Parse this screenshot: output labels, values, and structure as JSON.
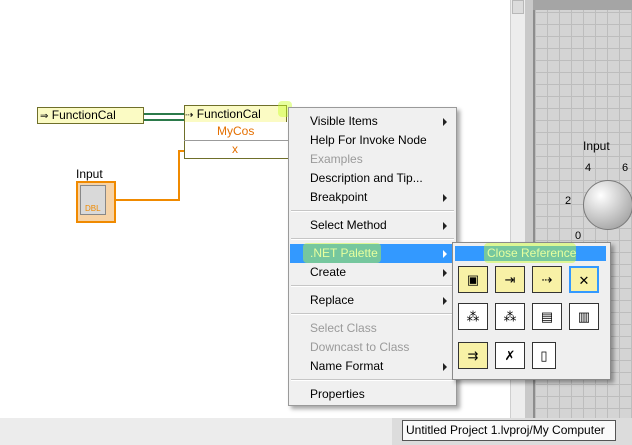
{
  "block_diagram": {
    "ref_node_label": "FunctionCal",
    "invoke_node_label": "FunctionCal",
    "method_name": "MyCos",
    "param_name": "x",
    "control_label": "Input",
    "control_type": "DBL"
  },
  "front_panel": {
    "knob_label": "Input",
    "knob_ticks": [
      "4",
      "6",
      "2",
      "0"
    ]
  },
  "context_menu": {
    "items": [
      {
        "label": "Visible Items",
        "submenu": true,
        "enabled": true
      },
      {
        "label": "Help For Invoke Node",
        "submenu": false,
        "enabled": true
      },
      {
        "label": "Examples",
        "submenu": false,
        "enabled": false
      },
      {
        "label": "Description and Tip...",
        "submenu": false,
        "enabled": true
      },
      {
        "label": "Breakpoint",
        "submenu": true,
        "enabled": true
      },
      {
        "label": "Select Method",
        "submenu": true,
        "enabled": true
      },
      {
        "label": ".NET Palette",
        "submenu": true,
        "enabled": true,
        "selected": true
      },
      {
        "label": "Create",
        "submenu": true,
        "enabled": true
      },
      {
        "label": "Replace",
        "submenu": true,
        "enabled": true
      },
      {
        "label": "Select Class",
        "submenu": false,
        "enabled": false
      },
      {
        "label": "Downcast to Class",
        "submenu": false,
        "enabled": false
      },
      {
        "label": "Name Format",
        "submenu": true,
        "enabled": true
      },
      {
        "label": "Properties",
        "submenu": false,
        "enabled": true
      }
    ]
  },
  "palette": {
    "highlighted_label": "Close Reference",
    "icons": [
      "constructor-node-icon",
      "property-node-icon",
      "invoke-node-icon",
      "close-reference-icon",
      "to-more-generic-class-icon",
      "to-more-specific-class-icon",
      "static-vi-reference-icon",
      "to-net-object-icon",
      "register-event-callback-icon",
      "unregister-for-events-icon",
      "net-container-icon"
    ]
  },
  "status_bar": {
    "text": "Untitled Project 1.lvproj/My Computer"
  },
  "colors": {
    "menu_highlight": "#3399ff",
    "annotation_highlight": "#c8ff28",
    "wire_orange": "#f08a00",
    "node_yellow": "#fbfbc4"
  }
}
